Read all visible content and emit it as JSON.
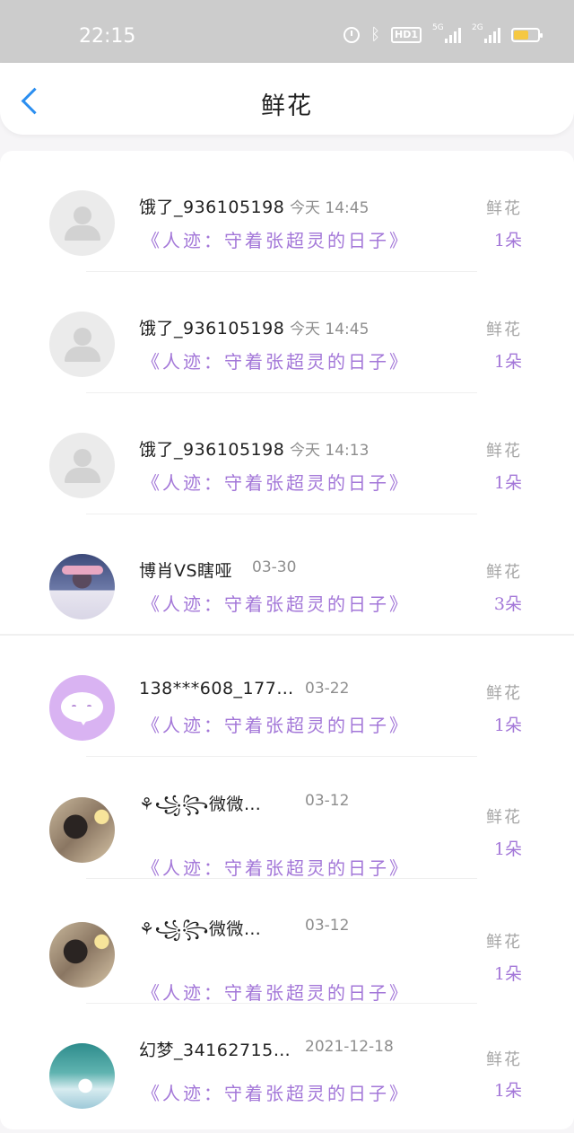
{
  "status_bar": {
    "time": "22:15",
    "hd_label": "HD1",
    "net1": "5G",
    "net2": "2G",
    "battery_level": 0.6
  },
  "header": {
    "title": "鲜花"
  },
  "list": [
    {
      "name": "饿了_936105198",
      "time": "今天 14:45",
      "book": "《人迹：守着张超灵的日子》",
      "gift_label": "鲜花",
      "gift_count": "1朵",
      "avatar": "default-avatar-icon"
    },
    {
      "name": "饿了_936105198",
      "time": "今天 14:45",
      "book": "《人迹：守着张超灵的日子》",
      "gift_label": "鲜花",
      "gift_count": "1朵",
      "avatar": "default-avatar-icon"
    },
    {
      "name": "饿了_936105198",
      "time": "今天 14:13",
      "book": "《人迹：守着张超灵的日子》",
      "gift_label": "鲜花",
      "gift_count": "1朵",
      "avatar": "default-avatar-icon"
    },
    {
      "name": "博肖VS瞎哑",
      "time": "03-30",
      "book": "《人迹：守着张超灵的日子》",
      "gift_label": "鲜花",
      "gift_count": "3朵",
      "avatar": "photo-avatar"
    },
    {
      "name": "138***608_177…",
      "time": "03-22",
      "book": "《人迹：守着张超灵的日子》",
      "gift_label": "鲜花",
      "gift_count": "1朵",
      "avatar": "chat-bubble-avatar"
    },
    {
      "name": "⚘꧁꧂微微…",
      "time": "03-12",
      "book": "《人迹：守着张超灵的日子》",
      "gift_label": "鲜花",
      "gift_count": "1朵",
      "avatar": "photo-avatar"
    },
    {
      "name": "⚘꧁꧂微微…",
      "time": "03-12",
      "book": "《人迹：守着张超灵的日子》",
      "gift_label": "鲜花",
      "gift_count": "1朵",
      "avatar": "photo-avatar"
    },
    {
      "name": "幻梦_34162715…",
      "time": "2021-12-18",
      "book": "《人迹：守着张超灵的日子》",
      "gift_label": "鲜花",
      "gift_count": "1朵",
      "avatar": "photo-avatar"
    }
  ]
}
